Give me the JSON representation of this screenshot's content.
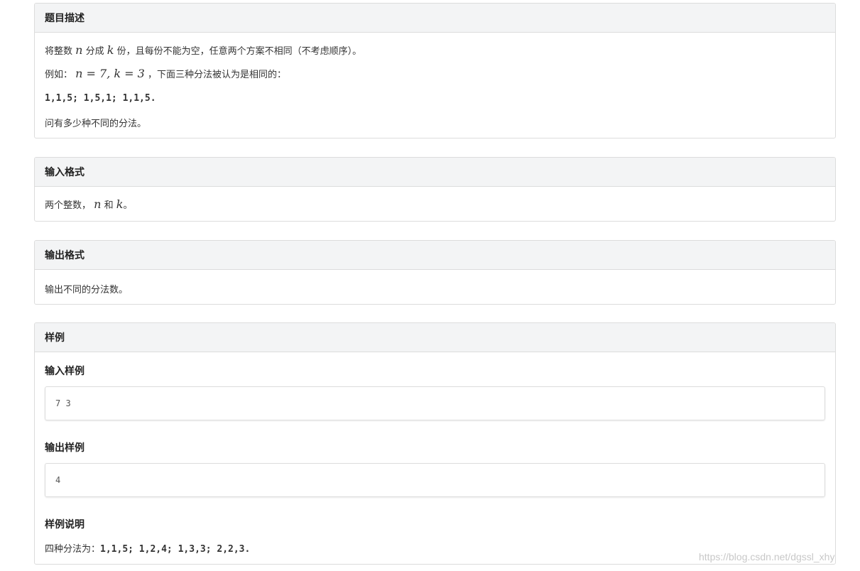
{
  "desc": {
    "title": "题目描述",
    "l1_a": "将整数",
    "l1_n": "n",
    "l1_b": "分成",
    "l1_k": "k",
    "l1_c": "份，且每份不能为空，任意两个方案不相同（不考虑顺序）。",
    "l2_a": "例如：",
    "l2_math": "n = 7, k = 3",
    "l2_b": "，下面三种分法被认为是相同的：",
    "l3": "1,1,5; 1,5,1; 1,1,5.",
    "l4": "问有多少种不同的分法。"
  },
  "input_format": {
    "title": "输入格式",
    "a": "两个整数，",
    "n": "n",
    "b": "和",
    "k": "k",
    "c": "。"
  },
  "output_format": {
    "title": "输出格式",
    "text": "输出不同的分法数。"
  },
  "sample": {
    "title": "样例",
    "input_label": "输入样例",
    "input_value": "7 3",
    "output_label": "输出样例",
    "output_value": "4",
    "explain_label": "样例说明",
    "explain_prefix": "四种分法为：",
    "explain_value": "1,1,5; 1,2,4; 1,3,3; 2,2,3."
  },
  "watermark": "https://blog.csdn.net/dgssl_xhy"
}
